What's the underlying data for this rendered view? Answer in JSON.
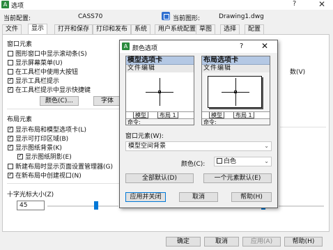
{
  "window": {
    "title": "选项",
    "help_glyph": "?",
    "close_glyph": "✕"
  },
  "profile": {
    "current_config_label": "当前配置:",
    "current_config_value": "CASS70",
    "current_drawing_label": "当前图形:",
    "current_drawing_value": "Drawing1.dwg"
  },
  "tabs": [
    {
      "label": "文件"
    },
    {
      "label": "显示"
    },
    {
      "label": "打开和保存"
    },
    {
      "label": "打印和发布"
    },
    {
      "label": "系统"
    },
    {
      "label": "用户系统配置"
    },
    {
      "label": "草图"
    },
    {
      "label": "选择"
    },
    {
      "label": "配置"
    }
  ],
  "window_elements": {
    "title": "窗口元素",
    "items": [
      {
        "label": "图形窗口中显示滚动条(S)",
        "checked": false
      },
      {
        "label": "显示屏幕菜单(U)",
        "checked": false
      },
      {
        "label": "在工具栏中使用大按钮",
        "checked": false
      },
      {
        "label": "显示工具栏提示",
        "checked": true
      },
      {
        "label": "在工具栏提示中显示快捷键",
        "checked": true
      }
    ],
    "colors_button": "颜色(C)...",
    "fonts_button": "字体(F)..."
  },
  "layout_elements": {
    "title": "布局元素",
    "items": [
      {
        "label": "显示布局和模型选项卡(L)",
        "checked": true
      },
      {
        "label": "显示可打印区域(B)",
        "checked": true
      },
      {
        "label": "显示图纸背景(K)",
        "checked": true
      },
      {
        "label": "显示图纸阴影(E)",
        "checked": true,
        "sub": true
      },
      {
        "label": "新建布局时显示页面设置管理器(G)",
        "checked": false
      },
      {
        "label": "在新布局中创建视口(N)",
        "checked": true
      }
    ]
  },
  "crosshair": {
    "title": "十字光标大小(Z)",
    "value": "45"
  },
  "right_partial": {
    "text": "数(V)"
  },
  "bottom_buttons": {
    "ok": "确定",
    "cancel": "取消",
    "apply": "应用(A)",
    "help": "帮助(H)"
  },
  "color_dialog": {
    "title": "颜色选项",
    "help_glyph": "?",
    "close_glyph": "✕",
    "preview_model": {
      "header": "模型选项卡",
      "menubar": "文件编辑",
      "tab_model": "模型",
      "tab_layout": "布局 1",
      "command": "命令:"
    },
    "preview_layout": {
      "header": "布局选项卡",
      "menubar": "文件编辑",
      "tab_model": "模型",
      "tab_layout": "布局 1",
      "command": "命令:"
    },
    "element_label": "窗口元素(W):",
    "element_value": "模型空间背景",
    "color_label": "颜色(C):",
    "color_value": "白色",
    "reset_all_button": "全部默认(D)",
    "reset_one_button": "一个元素默认(E)",
    "apply_close_button": "应用并关闭",
    "cancel_button": "取消",
    "help_button": "帮助(H)",
    "swatch_color": "#ffffff"
  }
}
